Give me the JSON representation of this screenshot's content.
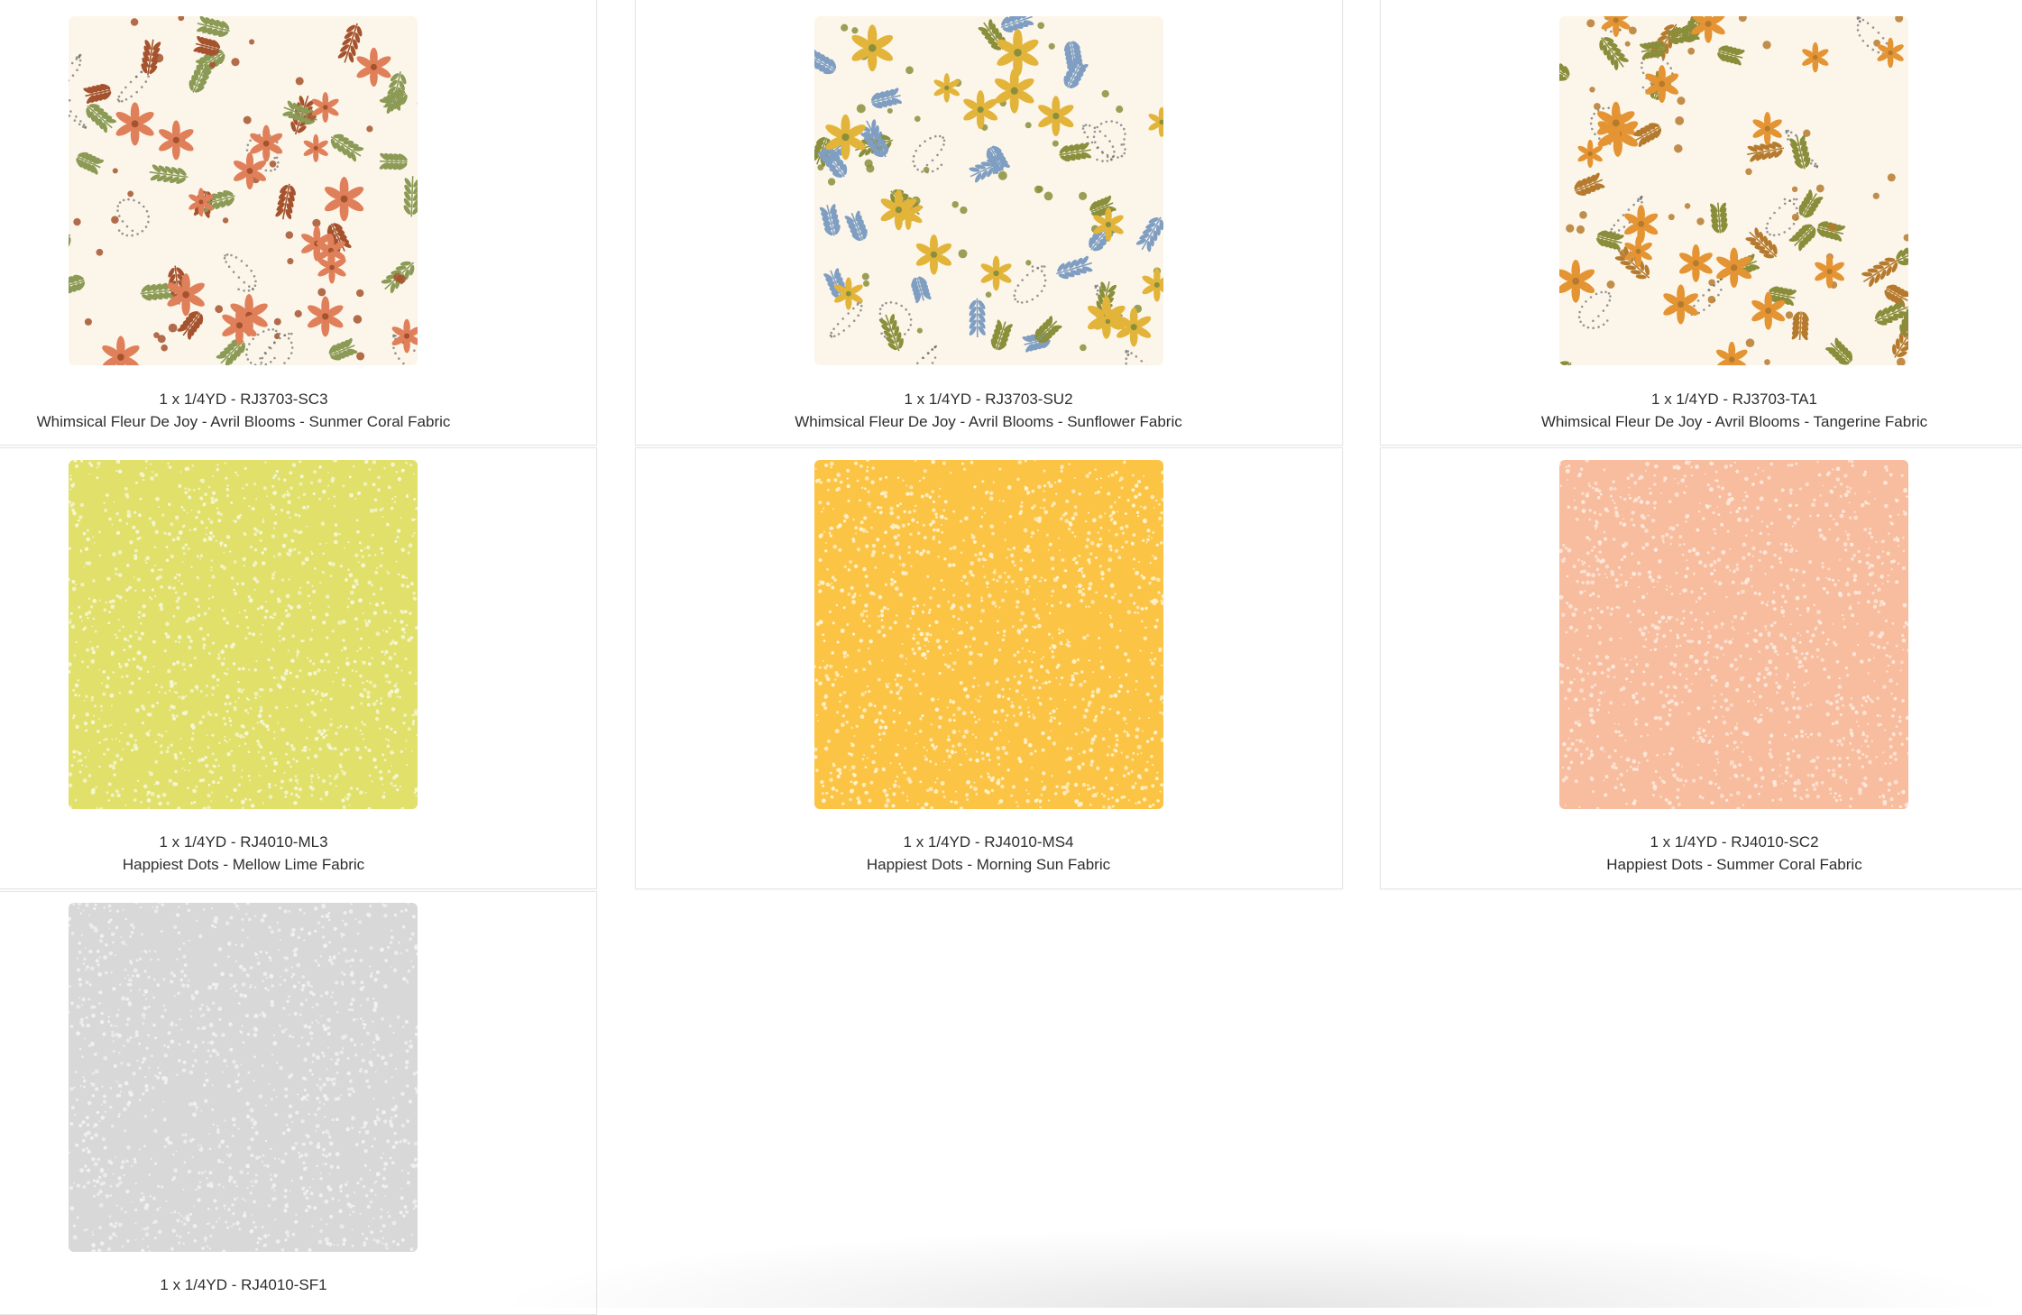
{
  "products": [
    {
      "id": "p1",
      "title": "1 x 1/4YD - RJ3703-SC3",
      "subtitle": "Whimsical Fleur De Joy - Avril Blooms - Sunmer Coral Fabric",
      "swatch": {
        "pattern": "floral",
        "background": "#fcf6ea",
        "flower": "#e0805a",
        "leaf": "#8b9a55",
        "accent": "#a5532e"
      }
    },
    {
      "id": "p2",
      "title": "1 x 1/4YD - RJ3703-SU2",
      "subtitle": "Whimsical Fleur De Joy - Avril Blooms - Sunflower Fabric",
      "swatch": {
        "pattern": "floral",
        "background": "#fcf6ea",
        "flower": "#e3b43a",
        "leaf": "#7f9ec2",
        "accent": "#8a8f3c"
      }
    },
    {
      "id": "p3",
      "title": "1 x 1/4YD - RJ3703-TA1",
      "subtitle": "Whimsical Fleur De Joy - Avril Blooms - Tangerine Fabric",
      "swatch": {
        "pattern": "floral",
        "background": "#fcf6ea",
        "flower": "#e49432",
        "leaf": "#8a8d3a",
        "accent": "#b57a2e"
      }
    },
    {
      "id": "p4",
      "title": "1 x 1/4YD - RJ4010-ML3",
      "subtitle": "Happiest Dots - Mellow Lime Fabric",
      "swatch": {
        "pattern": "dots",
        "background": "#e0e06a",
        "dot": "#f6f6d6"
      }
    },
    {
      "id": "p5",
      "title": "1 x 1/4YD - RJ4010-MS4",
      "subtitle": "Happiest Dots - Morning Sun Fabric",
      "swatch": {
        "pattern": "dots",
        "background": "#fbc445",
        "dot": "#fff2cf"
      }
    },
    {
      "id": "p6",
      "title": "1 x 1/4YD - RJ4010-SC2",
      "subtitle": "Happiest Dots - Summer Coral Fabric",
      "swatch": {
        "pattern": "dots",
        "background": "#f7bd9e",
        "dot": "#fde8dc"
      }
    },
    {
      "id": "p7",
      "title": "1 x 1/4YD - RJ4010-SF1",
      "subtitle": "",
      "swatch": {
        "pattern": "dots",
        "background": "#d8d8d8",
        "dot": "#f1f1f1"
      }
    }
  ]
}
